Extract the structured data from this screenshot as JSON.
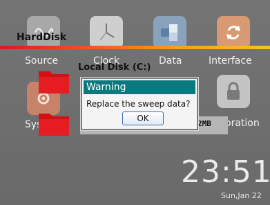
{
  "launcher": {
    "tiles": [
      {
        "label": "Source",
        "icon": "source-icon"
      },
      {
        "label": "Clock",
        "icon": "clock-icon"
      },
      {
        "label": "Data",
        "icon": "data-icon"
      },
      {
        "label": "Interface",
        "icon": "interface-icon"
      },
      {
        "label": "Sys",
        "icon": "system-icon"
      },
      {
        "label": "oration",
        "icon": "lock-icon"
      }
    ]
  },
  "harddisk": {
    "title": "HardDisk"
  },
  "browser": {
    "title": "Local Disk (C:)",
    "size": "2MB"
  },
  "dialog": {
    "title": "Warning",
    "message": "Replace the sweep data?",
    "ok_label": "OK"
  },
  "clock": {
    "time": "23:51",
    "date": "Sun,Jan 22"
  },
  "colors": {
    "dialog_title": "#0b7a7f",
    "folder": "#e0151c",
    "bar_start": "#e0151c",
    "bar_end": "#f7c21f"
  }
}
